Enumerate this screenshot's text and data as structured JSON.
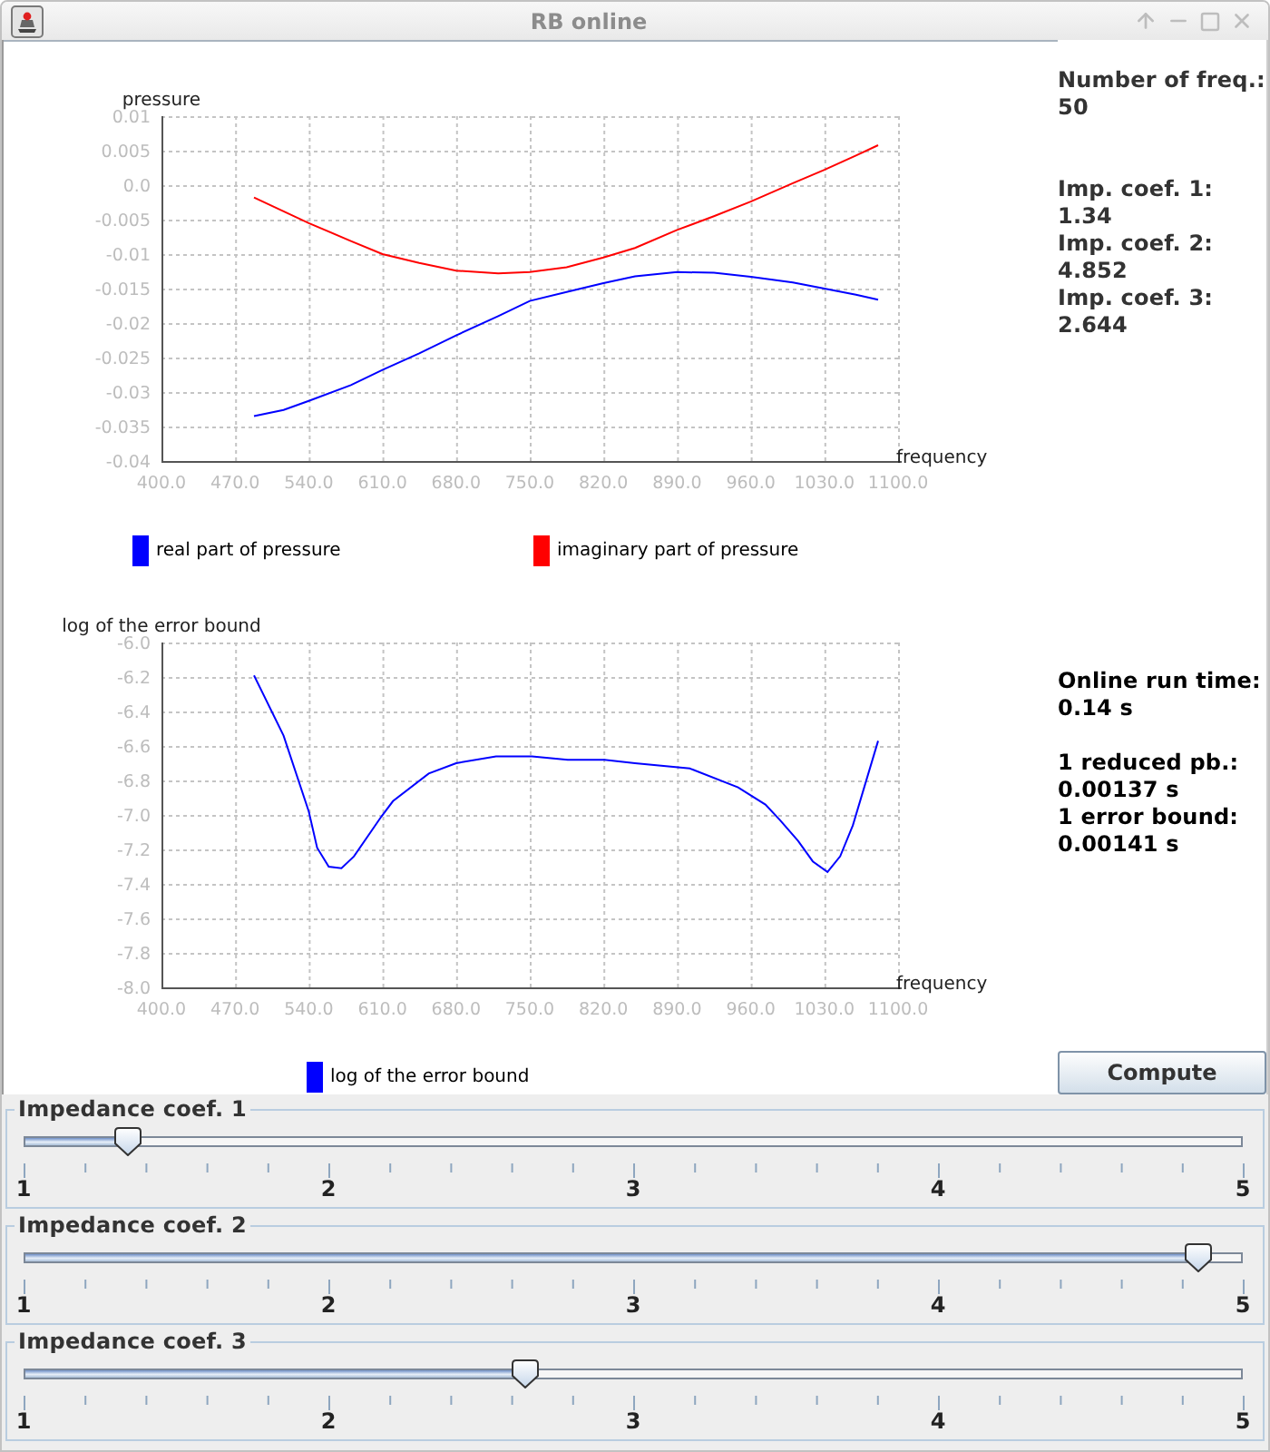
{
  "window": {
    "title": "RB online"
  },
  "charts": [
    {
      "chart_data": {
        "type": "line",
        "xlabel": "frequency",
        "ylabel": "pressure",
        "grid": true,
        "legend": true,
        "x": [
          488,
          516,
          540,
          580,
          610,
          645,
          680,
          720,
          750,
          785,
          820,
          850,
          890,
          925,
          960,
          1000,
          1030,
          1060,
          1081
        ],
        "series": [
          {
            "name": "real part of pressure",
            "color": "#0000ff",
            "values": [
              -0.0335,
              -0.0326,
              -0.0313,
              -0.029,
              -0.0268,
              -0.0244,
              -0.0218,
              -0.019,
              -0.0168,
              -0.0155,
              -0.0142,
              -0.0132,
              -0.0126,
              -0.0127,
              -0.0133,
              -0.0141,
              -0.015,
              -0.0159,
              -0.0166
            ]
          },
          {
            "name": "imaginary part of pressure",
            "color": "#ff0000",
            "values": [
              -0.0018,
              -0.0038,
              -0.0055,
              -0.0081,
              -0.01,
              -0.0113,
              -0.0124,
              -0.0128,
              -0.0126,
              -0.0119,
              -0.0105,
              -0.0091,
              -0.0065,
              -0.0045,
              -0.0024,
              0.0003,
              0.0022,
              0.0043,
              0.0058
            ]
          }
        ],
        "xlim": [
          400,
          1100
        ],
        "ylim": [
          -0.04,
          0.01
        ],
        "xticks": [
          {
            "value": 400,
            "label": "400.0"
          },
          {
            "value": 470,
            "label": "470.0"
          },
          {
            "value": 540,
            "label": "540.0"
          },
          {
            "value": 610,
            "label": "610.0"
          },
          {
            "value": 680,
            "label": "680.0"
          },
          {
            "value": 750,
            "label": "750.0"
          },
          {
            "value": 820,
            "label": "820.0"
          },
          {
            "value": 890,
            "label": "890.0"
          },
          {
            "value": 960,
            "label": "960.0"
          },
          {
            "value": 1030,
            "label": "1030.0"
          },
          {
            "value": 1100,
            "label": "1100.0"
          }
        ],
        "yticks": [
          {
            "value": 0.01,
            "label": "0.01"
          },
          {
            "value": 0.005,
            "label": "0.005"
          },
          {
            "value": 0,
            "label": "0.0"
          },
          {
            "value": -0.005,
            "label": "-0.005"
          },
          {
            "value": -0.01,
            "label": "-0.01"
          },
          {
            "value": -0.015,
            "label": "-0.015"
          },
          {
            "value": -0.02,
            "label": "-0.02"
          },
          {
            "value": -0.025,
            "label": "-0.025"
          },
          {
            "value": -0.03,
            "label": "-0.03"
          },
          {
            "value": -0.035,
            "label": "-0.035"
          },
          {
            "value": -0.04,
            "label": "-0.04"
          }
        ]
      }
    },
    {
      "chart_data": {
        "type": "line",
        "xlabel": "frequency",
        "ylabel": "log of the error bound",
        "grid": true,
        "legend": true,
        "x": [
          488,
          516,
          540,
          548,
          559,
          571,
          583,
          609,
          620,
          654,
          680,
          718,
          752,
          786,
          821,
          850,
          902,
          948,
          974,
          988,
          1005,
          1019,
          1033,
          1045,
          1057,
          1081
        ],
        "series": [
          {
            "name": "log of the error bound",
            "color": "#0000ff",
            "values": [
              -6.19,
              -6.54,
              -6.98,
              -7.19,
              -7.3,
              -7.31,
              -7.24,
              -7.01,
              -6.92,
              -6.76,
              -6.7,
              -6.66,
              -6.66,
              -6.68,
              -6.68,
              -6.7,
              -6.73,
              -6.84,
              -6.94,
              -7.03,
              -7.15,
              -7.27,
              -7.33,
              -7.24,
              -7.06,
              -6.57
            ]
          }
        ],
        "xlim": [
          400,
          1100
        ],
        "ylim": [
          -8,
          -6
        ],
        "xticks": [
          {
            "value": 400,
            "label": "400.0"
          },
          {
            "value": 470,
            "label": "470.0"
          },
          {
            "value": 540,
            "label": "540.0"
          },
          {
            "value": 610,
            "label": "610.0"
          },
          {
            "value": 680,
            "label": "680.0"
          },
          {
            "value": 750,
            "label": "750.0"
          },
          {
            "value": 820,
            "label": "820.0"
          },
          {
            "value": 890,
            "label": "890.0"
          },
          {
            "value": 960,
            "label": "960.0"
          },
          {
            "value": 1030,
            "label": "1030.0"
          },
          {
            "value": 1100,
            "label": "1100.0"
          }
        ],
        "yticks": [
          {
            "value": -6,
            "label": "-6.0"
          },
          {
            "value": -6.2,
            "label": "-6.2"
          },
          {
            "value": -6.4,
            "label": "-6.4"
          },
          {
            "value": -6.6,
            "label": "-6.6"
          },
          {
            "value": -6.8,
            "label": "-6.8"
          },
          {
            "value": -7,
            "label": "-7.0"
          },
          {
            "value": -7.2,
            "label": "-7.2"
          },
          {
            "value": -7.4,
            "label": "-7.4"
          },
          {
            "value": -7.6,
            "label": "-7.6"
          },
          {
            "value": -7.8,
            "label": "-7.8"
          },
          {
            "value": -8,
            "label": "-8.0"
          }
        ]
      }
    }
  ],
  "info_panel": {
    "groups": [
      {
        "items": [
          {
            "label": "Number of freq.:",
            "value": "50"
          }
        ]
      },
      {
        "items": [
          {
            "label": "Imp. coef. 1:",
            "value": "1.34"
          },
          {
            "label": "Imp. coef. 2:",
            "value": "4.852"
          },
          {
            "label": "Imp. coef. 3:",
            "value": "2.644"
          }
        ]
      }
    ]
  },
  "timing_panel": {
    "groups": [
      {
        "items": [
          {
            "label": "Online run time:",
            "value": "0.14 s"
          }
        ]
      },
      {
        "items": [
          {
            "label": "1 reduced pb.:",
            "value": "0.00137 s"
          },
          {
            "label": "1 error bound:",
            "value": "0.00141 s"
          }
        ]
      }
    ]
  },
  "compute_button": {
    "label": "Compute"
  },
  "sliders": [
    {
      "title": "Impedance coef. 1",
      "level": 0.085,
      "tick_labels": [
        "1",
        "2",
        "3",
        "4",
        "5"
      ]
    },
    {
      "title": "Impedance coef. 2",
      "level": 0.963,
      "tick_labels": [
        "1",
        "2",
        "3",
        "4",
        "5"
      ]
    },
    {
      "title": "Impedance coef. 3",
      "level": 0.411,
      "tick_labels": [
        "1",
        "2",
        "3",
        "4",
        "5"
      ]
    }
  ]
}
